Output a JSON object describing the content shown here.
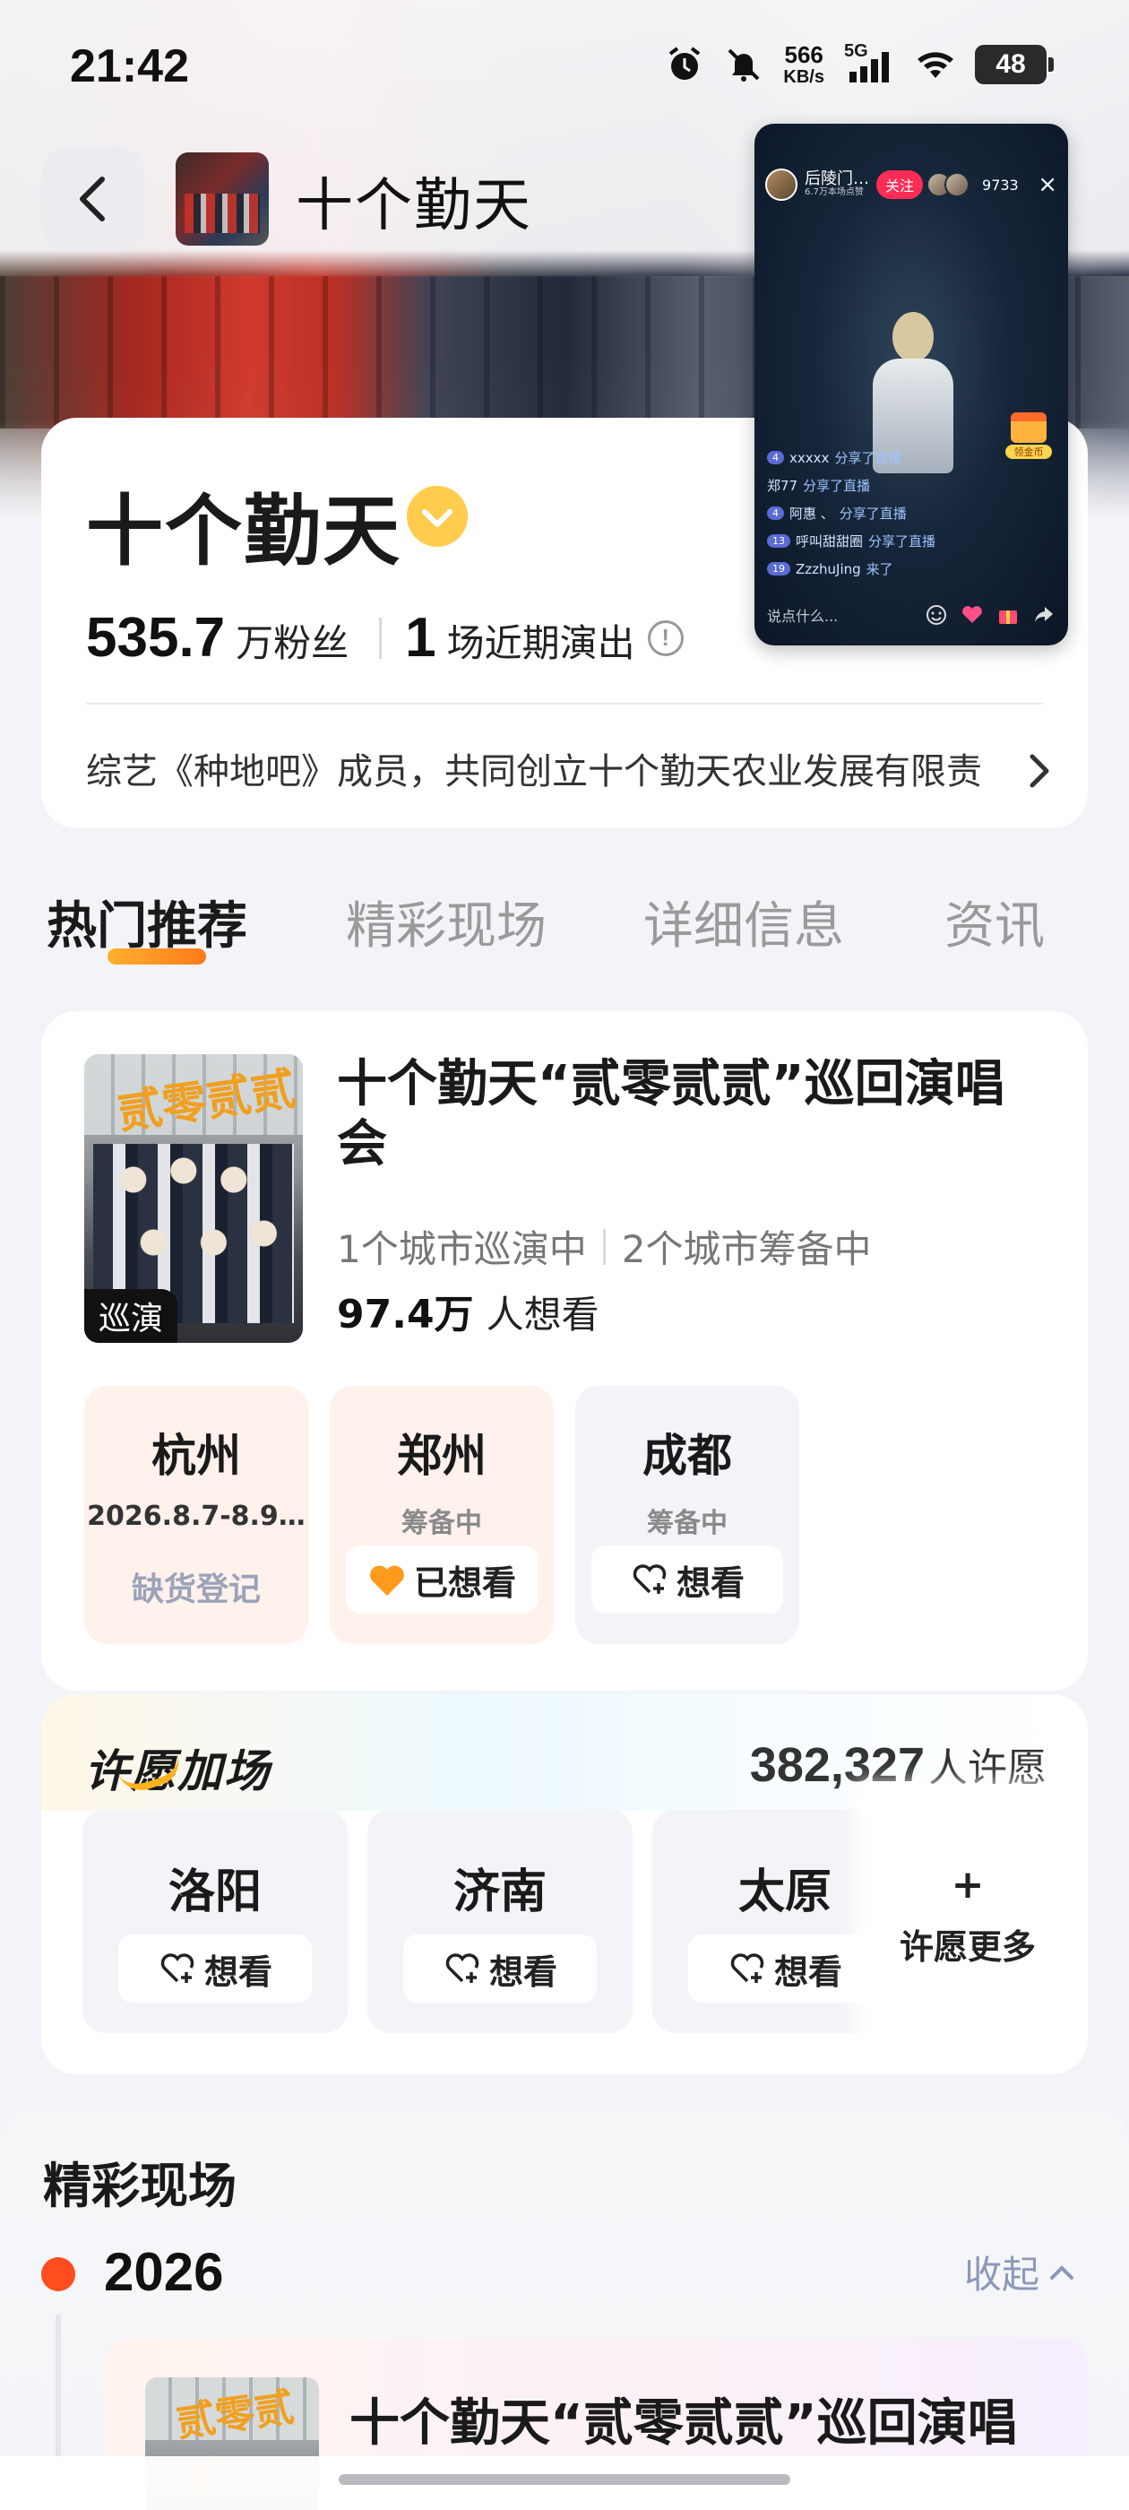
{
  "status_bar": {
    "time": "21:42",
    "net_speed_value": "566",
    "net_speed_unit": "KB/s",
    "network": "5G",
    "battery": "48",
    "icons": [
      "alarm-icon",
      "bell-off-icon",
      "signal-icon",
      "wifi-icon",
      "battery-icon"
    ]
  },
  "header": {
    "title": "十个勤天"
  },
  "live_window": {
    "host_name": "后陵门…",
    "host_sub": "6.7万本场点赞",
    "follow_label": "关注",
    "viewer_count": "9733",
    "close_label": "×",
    "gift_tag": "领金币",
    "comments": [
      {
        "level": "4",
        "user": "xxxxx",
        "action": "分享了直播"
      },
      {
        "level": "",
        "user": "郑77",
        "action": "分享了直播"
      },
      {
        "level": "4",
        "user": "阿惠 、",
        "action": "分享了直播"
      },
      {
        "level": "13",
        "user": "呼叫甜甜圈",
        "action": "分享了直播"
      },
      {
        "level": "19",
        "user": "ZzzhuJing",
        "action": "来了"
      }
    ],
    "input_placeholder": "说点什么..."
  },
  "artist": {
    "name": "十个勤天",
    "fans_value": "535.7",
    "fans_label": "万粉丝",
    "shows_value": "1",
    "shows_label": "场近期演出",
    "bio": "综艺《种地吧》成员，共同创立十个勤天农业发展有限责"
  },
  "tabs": [
    {
      "label": "热门推荐",
      "active": true
    },
    {
      "label": "精彩现场",
      "active": false
    },
    {
      "label": "详细信息",
      "active": false
    },
    {
      "label": "资讯",
      "active": false
    }
  ],
  "tour": {
    "poster_badge": "巡演",
    "title": "十个勤天“贰零贰贰”巡回演唱会",
    "touring": "1个城市巡演中",
    "preparing": "2个城市筹备中",
    "want_count": "97.4万",
    "want_label": "人想看",
    "cities": [
      {
        "name": "杭州",
        "sub": "2026.8.7-8.9…",
        "action": "缺货登记"
      },
      {
        "name": "郑州",
        "sub": "筹备中",
        "action": "已想看"
      },
      {
        "name": "成都",
        "sub": "筹备中",
        "action": "想看"
      }
    ]
  },
  "wish": {
    "title": "许愿加场",
    "count": "382,327",
    "count_label": "人许愿",
    "cities": [
      {
        "name": "洛阳",
        "action": "想看"
      },
      {
        "name": "济南",
        "action": "想看"
      },
      {
        "name": "太原",
        "action": "想看"
      }
    ],
    "more_plus": "+",
    "more_label": "许愿更多"
  },
  "highlights": {
    "title": "精彩现场",
    "year": "2026",
    "collapse_label": "收起",
    "item_title": "十个勤天“贰零贰贰”巡回演唱"
  },
  "colors": {
    "accent_orange": "#ff7a1a",
    "year_dot": "#ff4d1f",
    "collapse_text": "#8b98b8",
    "verified_badge": "#ffcc4d",
    "follow_button": "#ff2c55"
  }
}
